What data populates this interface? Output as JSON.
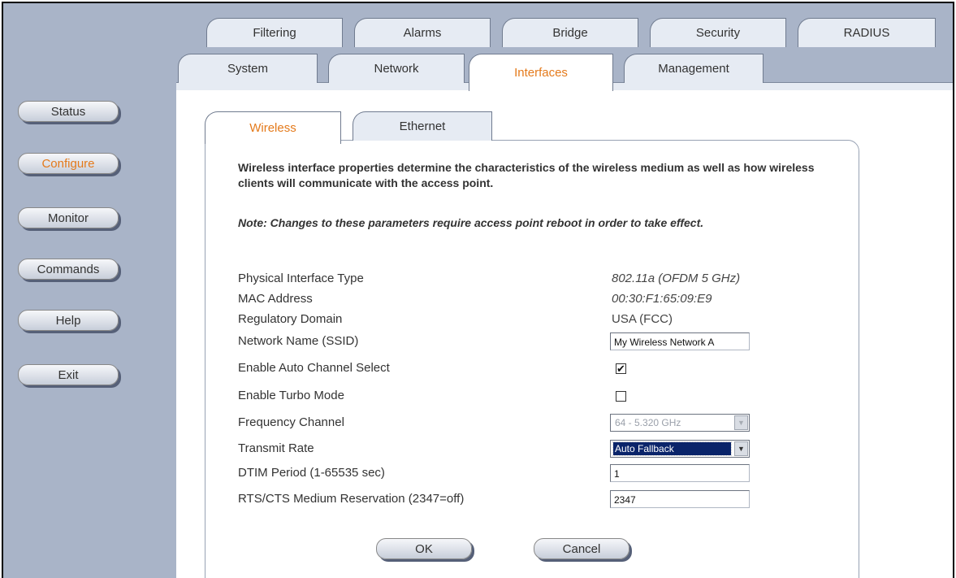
{
  "tabs_row1": [
    "Filtering",
    "Alarms",
    "Bridge",
    "Security",
    "RADIUS"
  ],
  "tabs_row2": [
    "System",
    "Network",
    "Interfaces",
    "Management"
  ],
  "nav": [
    "Status",
    "Configure",
    "Monitor",
    "Commands",
    "Help",
    "Exit"
  ],
  "subtabs": [
    "Wireless",
    "Ethernet"
  ],
  "description": "Wireless interface properties determine the characteristics of the wireless medium as well as how wireless clients will communicate with the access point.",
  "note": "Note: Changes to these parameters require access point reboot in order to take effect.",
  "props": {
    "phy_type": {
      "label": "Physical Interface Type",
      "value": "802.11a (OFDM 5 GHz)"
    },
    "mac": {
      "label": "MAC Address",
      "value": "00:30:F1:65:09:E9"
    },
    "reg_domain": {
      "label": "Regulatory Domain",
      "value": "USA (FCC)"
    },
    "ssid": {
      "label": "Network Name (SSID)",
      "value": "My Wireless Network A"
    },
    "auto_channel": {
      "label": "Enable Auto Channel Select",
      "value": "✔"
    },
    "turbo": {
      "label": "Enable Turbo Mode",
      "value": ""
    },
    "freq": {
      "label": "Frequency Channel",
      "value": "64 - 5.320 GHz"
    },
    "tx_rate": {
      "label": "Transmit Rate",
      "value": "Auto Fallback"
    },
    "dtim": {
      "label": "DTIM Period (1-65535 sec)",
      "value": "1"
    },
    "rts": {
      "label": "RTS/CTS Medium Reservation (2347=off)",
      "value": "2347"
    }
  },
  "buttons": {
    "ok": "OK",
    "cancel": "Cancel"
  },
  "colors": {
    "active": "#e47a1b",
    "band": "#a9b4c8"
  }
}
